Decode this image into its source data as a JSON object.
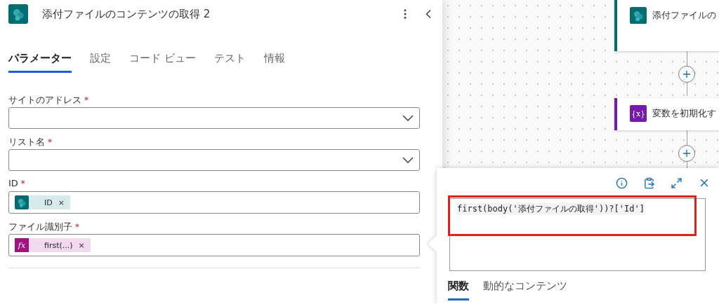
{
  "panel": {
    "title": "添付ファイルのコンテンツの取得 2",
    "tabs": [
      {
        "label": "パラメーター",
        "selected": true
      },
      {
        "label": "設定",
        "selected": false
      },
      {
        "label": "コード ビュー",
        "selected": false
      },
      {
        "label": "テスト",
        "selected": false
      },
      {
        "label": "情報",
        "selected": false
      }
    ],
    "fields": [
      {
        "label": "サイトのアドレス",
        "required_mark": "*",
        "kind": "dropdown"
      },
      {
        "label": "リスト名",
        "required_mark": "*",
        "kind": "dropdown"
      },
      {
        "label": "ID",
        "required_mark": "*",
        "kind": "token",
        "token": {
          "kind": "sharepoint",
          "label": "ID",
          "remove": "×"
        }
      },
      {
        "label": "ファイル識別子",
        "required_mark": "*",
        "kind": "token",
        "token": {
          "kind": "expression",
          "icon_label": "fx",
          "label": "first(...)",
          "remove": "×"
        }
      }
    ]
  },
  "canvas": {
    "nodes": [
      {
        "kind": "sharepoint",
        "title": "添付ファイルの"
      },
      {
        "kind": "variable",
        "icon_label": "{x}",
        "title": "変数を初期化す"
      }
    ]
  },
  "popup": {
    "expression": "first(body('添付ファイルの取得'))?['Id']",
    "highlighted": true,
    "tabs": [
      {
        "label": "関数",
        "selected": true
      },
      {
        "label": "動的なコンテンツ",
        "selected": false
      }
    ]
  }
}
